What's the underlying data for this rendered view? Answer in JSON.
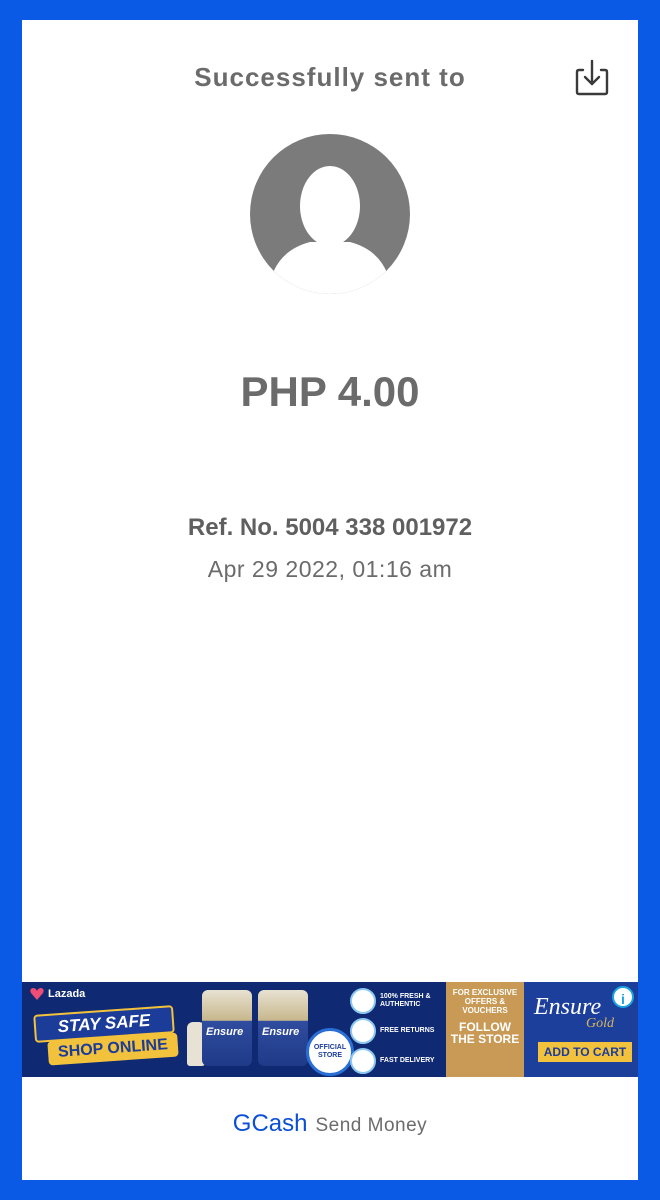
{
  "receipt": {
    "title": "Successfully sent to",
    "amount": "PHP 4.00",
    "ref_no": "Ref. No. 5004 338 001972",
    "datetime": "Apr 29 2022, 01:16 am"
  },
  "icons": {
    "download": "download-icon",
    "avatar": "default-user-avatar",
    "ad_info": "info-icon"
  },
  "ad": {
    "brand": "Lazada",
    "stay_safe": "STAY SAFE",
    "shop_online": "SHOP ONLINE",
    "can_label": "Ensure",
    "official": "OFFICIAL STORE",
    "perks": [
      "100% FRESH & AUTHENTIC",
      "FREE RETURNS",
      "FAST DELIVERY"
    ],
    "store_small": "FOR EXCLUSIVE OFFERS & VOUCHERS",
    "store_big": "FOLLOW THE STORE",
    "product": "Ensure",
    "product_sub": "Gold",
    "cta": "ADD TO CART",
    "info": "i"
  },
  "footer": {
    "brand": "GCash",
    "label": "Send Money"
  },
  "colors": {
    "background": "#0a5ae6",
    "text_gray": "#6b6b6b",
    "gcash_blue": "#0a4fd6"
  }
}
